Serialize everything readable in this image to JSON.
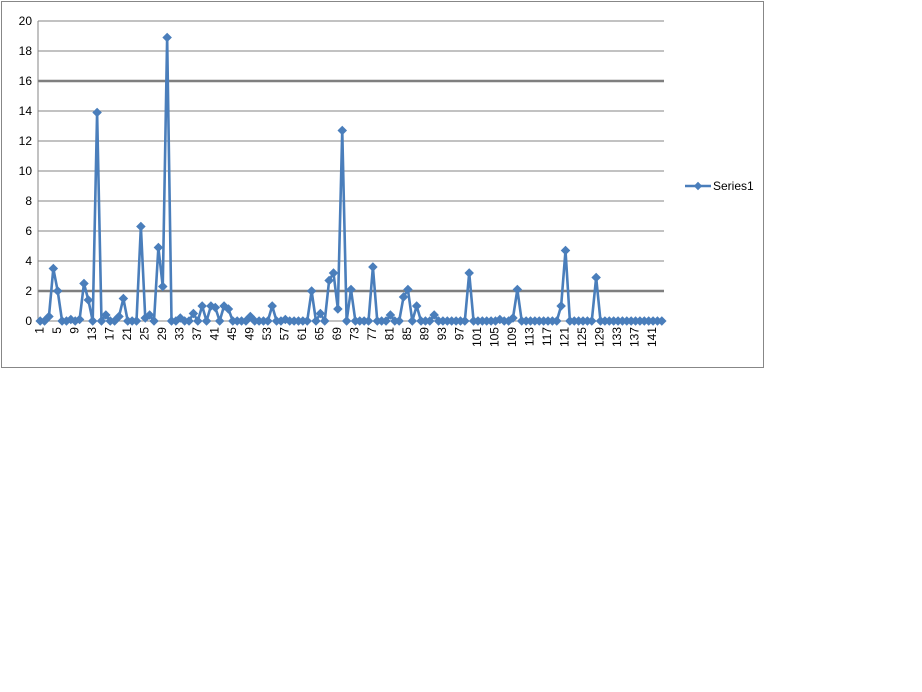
{
  "chart_data": {
    "type": "line",
    "title": "",
    "xlabel": "",
    "ylabel": "",
    "ylim": [
      0,
      20
    ],
    "y_ticks": [
      0,
      2,
      4,
      6,
      8,
      10,
      12,
      14,
      16,
      18,
      20
    ],
    "x_tick_labels": [
      "1",
      "5",
      "9",
      "13",
      "17",
      "21",
      "25",
      "29",
      "33",
      "37",
      "41",
      "45",
      "49",
      "53",
      "57",
      "61",
      "65",
      "69",
      "73",
      "77",
      "81",
      "85",
      "89",
      "93",
      "97",
      "101",
      "105",
      "109",
      "113",
      "117",
      "121",
      "125",
      "129",
      "133",
      "137",
      "141"
    ],
    "x_tick_rotation": "vertical",
    "grid": "horizontal",
    "emphasized_gridlines": [
      2,
      16
    ],
    "legend_position": "right",
    "marker": "diamond",
    "line_color": "#4a7ebb",
    "series": [
      {
        "name": "Series1",
        "x_start": 1,
        "values": [
          0,
          0,
          0.3,
          3.5,
          2,
          0,
          0,
          0.1,
          0,
          0.1,
          2.5,
          1.4,
          0,
          13.9,
          0,
          0.4,
          0,
          0,
          0.3,
          1.5,
          0,
          0,
          0,
          6.3,
          0.2,
          0.4,
          0,
          4.9,
          2.3,
          18.9,
          0,
          0,
          0.2,
          0,
          0,
          0.5,
          0,
          1,
          0,
          1,
          0.9,
          0,
          1,
          0.8,
          0,
          0,
          0,
          0,
          0.3,
          0,
          0,
          0,
          0,
          1,
          0,
          0,
          0.1,
          0,
          0,
          0,
          0,
          0,
          2,
          0,
          0.5,
          0,
          2.7,
          3.2,
          0.8,
          12.7,
          0,
          2.1,
          0,
          0,
          0,
          0,
          3.6,
          0,
          0,
          0,
          0.4,
          0,
          0,
          1.6,
          2.1,
          0,
          1,
          0,
          0,
          0,
          0.4,
          0,
          0,
          0,
          0,
          0,
          0,
          0,
          3.2,
          0,
          0,
          0,
          0,
          0,
          0,
          0.1,
          0,
          0,
          0.2,
          2.1,
          0,
          0,
          0,
          0,
          0,
          0,
          0,
          0,
          0,
          1,
          4.7,
          0,
          0,
          0,
          0,
          0,
          0,
          2.9,
          0,
          0,
          0,
          0,
          0,
          0,
          0,
          0,
          0,
          0,
          0,
          0,
          0,
          0,
          0
        ]
      }
    ]
  }
}
